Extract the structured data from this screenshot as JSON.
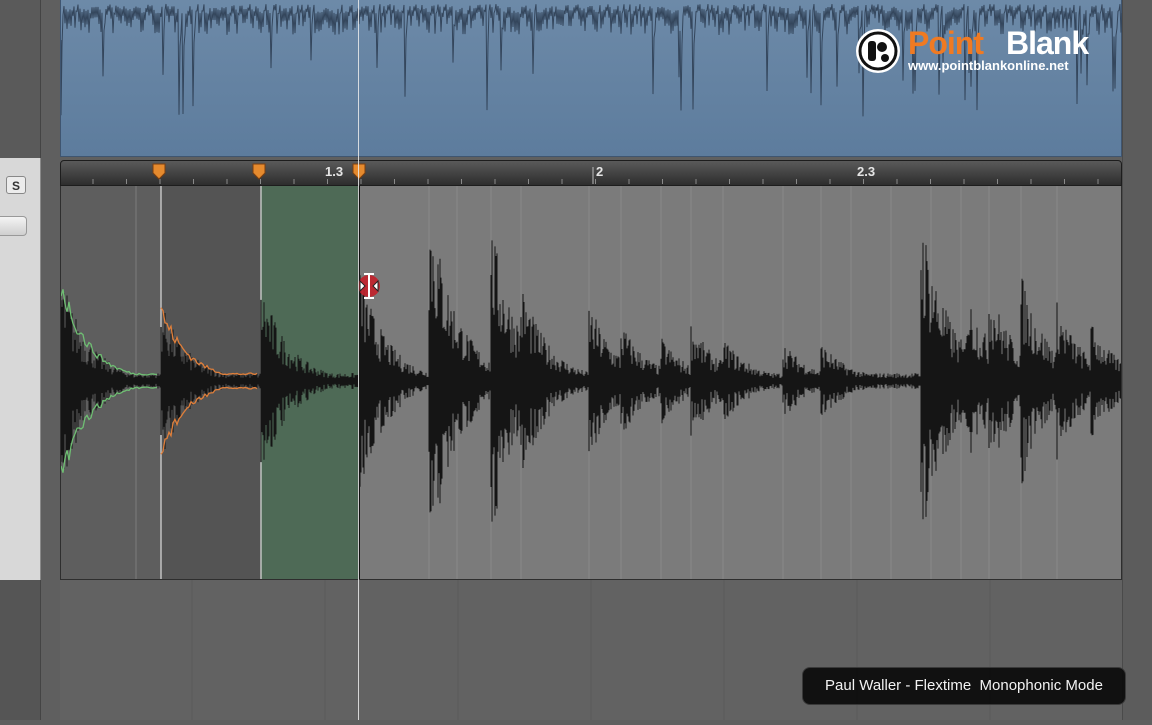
{
  "track_header": {
    "solo_label": "S"
  },
  "ruler": {
    "labels": [
      "1.3",
      "2",
      "2.3"
    ]
  },
  "logo": {
    "name_part1": "Point",
    "name_part2": "Blank",
    "url": "www.pointblankonline.net"
  },
  "caption": {
    "text": "Paul Waller - Flextime  Monophonic Mode"
  },
  "colors": {
    "top_region": "#6d8aa8",
    "main_region": "#7b7b7b",
    "waveform": "#151515",
    "flex_segment_green": "#6fbf73",
    "flex_segment_orange": "#e07f3a",
    "selected_segment": "#4e6a56",
    "flex_marker": "#e58a2e",
    "logo_accent": "#f07a22"
  },
  "icons": {
    "cursor": "flex-tool-cursor-icon",
    "logo": "pointblank-logo-icon",
    "flex_marker": "flex-marker-icon"
  }
}
